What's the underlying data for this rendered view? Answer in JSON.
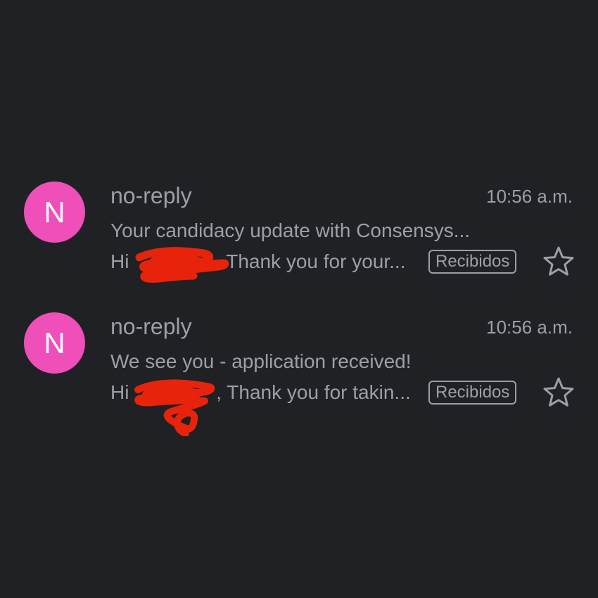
{
  "emails": [
    {
      "avatar_letter": "N",
      "sender": "no-reply",
      "time": "10:56 a.m.",
      "subject": "Your candidacy update with Consensys...",
      "snippet_prefix": "Hi ",
      "snippet_suffix": "Thank you for your...",
      "label": "Recibidos",
      "starred": false
    },
    {
      "avatar_letter": "N",
      "sender": "no-reply",
      "time": "10:56 a.m.",
      "subject": "We see you - application received!",
      "snippet_prefix": "Hi ",
      "snippet_suffix": ", Thank you for takin...",
      "label": "Recibidos",
      "starred": false
    }
  ],
  "colors": {
    "background": "#202124",
    "avatar": "#ee4fb9",
    "text": "#9aa0a6",
    "redaction": "#e8230c"
  },
  "icons": {
    "star": "star-outline-icon"
  }
}
